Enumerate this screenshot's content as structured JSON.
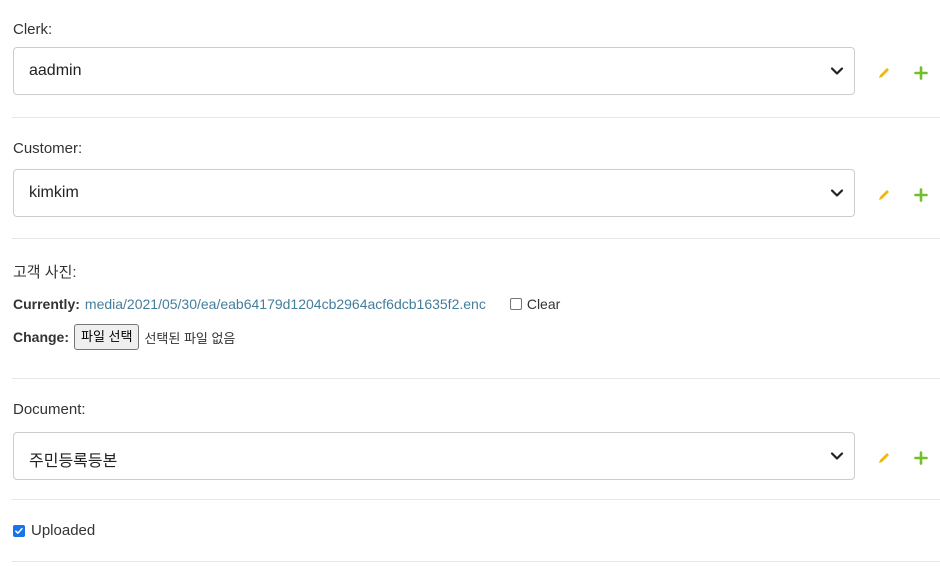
{
  "clerk": {
    "label": "Clerk:",
    "value": "aadmin",
    "edit_icon": "pencil-icon",
    "add_icon": "plus-icon"
  },
  "customer": {
    "label": "Customer:",
    "value": "kimkim",
    "edit_icon": "pencil-icon",
    "add_icon": "plus-icon"
  },
  "photo": {
    "label": "고객 사진:",
    "currently_label": "Currently:",
    "current_file": "media/2021/05/30/ea/eab64179d1204cb2964acf6dcb1635f2.enc",
    "clear_label": "Clear",
    "clear_checked": false,
    "change_label": "Change:",
    "choose_button": "파일 선택",
    "no_file_text": "선택된 파일 없음"
  },
  "document": {
    "label": "Document:",
    "value": "주민등록등본",
    "edit_icon": "pencil-icon",
    "add_icon": "plus-icon"
  },
  "uploaded": {
    "label": "Uploaded",
    "checked": true
  },
  "colors": {
    "link": "#447e9b",
    "edit_icon": "#efb80b",
    "add_icon": "#70bf2b",
    "checkbox_checked": "#1a73e8",
    "divider": "#e6e6e6"
  }
}
